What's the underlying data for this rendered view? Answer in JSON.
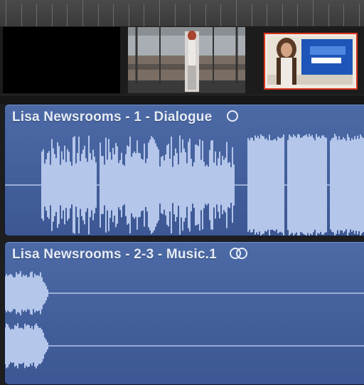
{
  "timeline": {
    "video_clips": [
      {
        "name": "black-frame"
      },
      {
        "name": "newsroom-frame"
      },
      {
        "name": "presenter-frame"
      }
    ],
    "audio_clips": [
      {
        "title": "Lisa Newsrooms - 1 - Dialogue",
        "role_icon": "single-circle-icon"
      },
      {
        "title": "Lisa Newsrooms - 2-3 - Music.1",
        "role_icon": "double-circle-icon"
      }
    ]
  },
  "colors": {
    "audio_clip": "#4563a0",
    "waveform": "#b4c6ea",
    "selection_border": "#d9331b"
  }
}
